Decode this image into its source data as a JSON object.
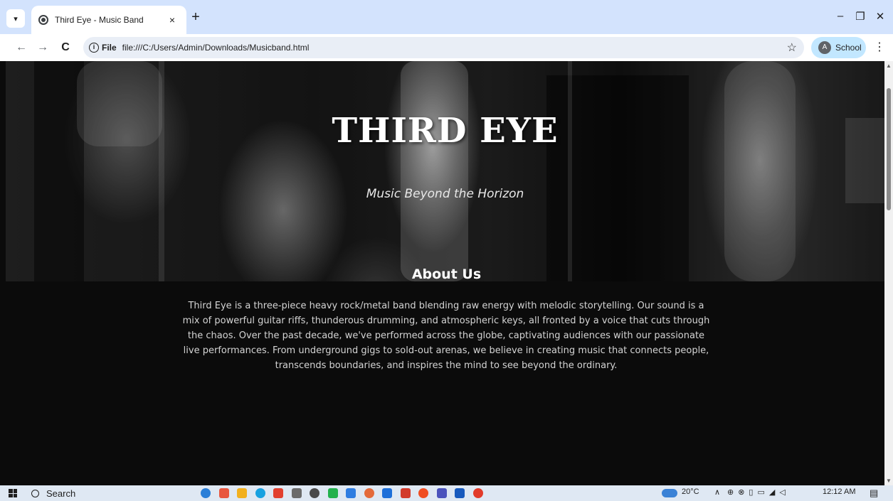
{
  "browser": {
    "tab_title": "Third Eye - Music Band",
    "tab_close": "×",
    "new_tab": "+",
    "minimize": "–",
    "restore": "❐",
    "close": "✕",
    "back": "←",
    "forward": "→",
    "reload": "C",
    "chip_label": "File",
    "url": "file:///C:/Users/Admin/Downloads/Musicband.html",
    "bookmark_star": "☆",
    "profile_initial": "A",
    "profile_name": "School",
    "menu": "⋮"
  },
  "hero": {
    "title": "THIRD EYE",
    "tagline": "Music Beyond the Horizon"
  },
  "about": {
    "heading": "About Us",
    "text": "Third Eye is a three-piece heavy rock/metal band blending raw energy with melodic storytelling. Our sound is a mix of powerful guitar riffs, thunderous drumming, and atmospheric keys, all fronted by a voice that cuts through the chaos. Over the past decade, we've performed across the globe, captivating audiences with our passionate live performances. From underground gigs to sold-out arenas, we believe in creating music that connects people, transcends boundaries, and inspires the mind to see beyond the ordinary."
  },
  "taskbar": {
    "search_label": "Search",
    "temperature": "20°C",
    "tray_symbols": "∧",
    "time": "12:12 AM",
    "app_icon_colors": [
      "#2b7fd8",
      "#e8563f",
      "#f2b01e",
      "#18a1e0",
      "#e2402f",
      "#6b6b6b",
      "#4a4a4a",
      "#23b14d",
      "#2f7de1",
      "#e46a3a",
      "#1e6fd9",
      "#d23a2b",
      "#f04e23",
      "#4b53bc",
      "#185abd",
      "#e23b2a"
    ]
  }
}
